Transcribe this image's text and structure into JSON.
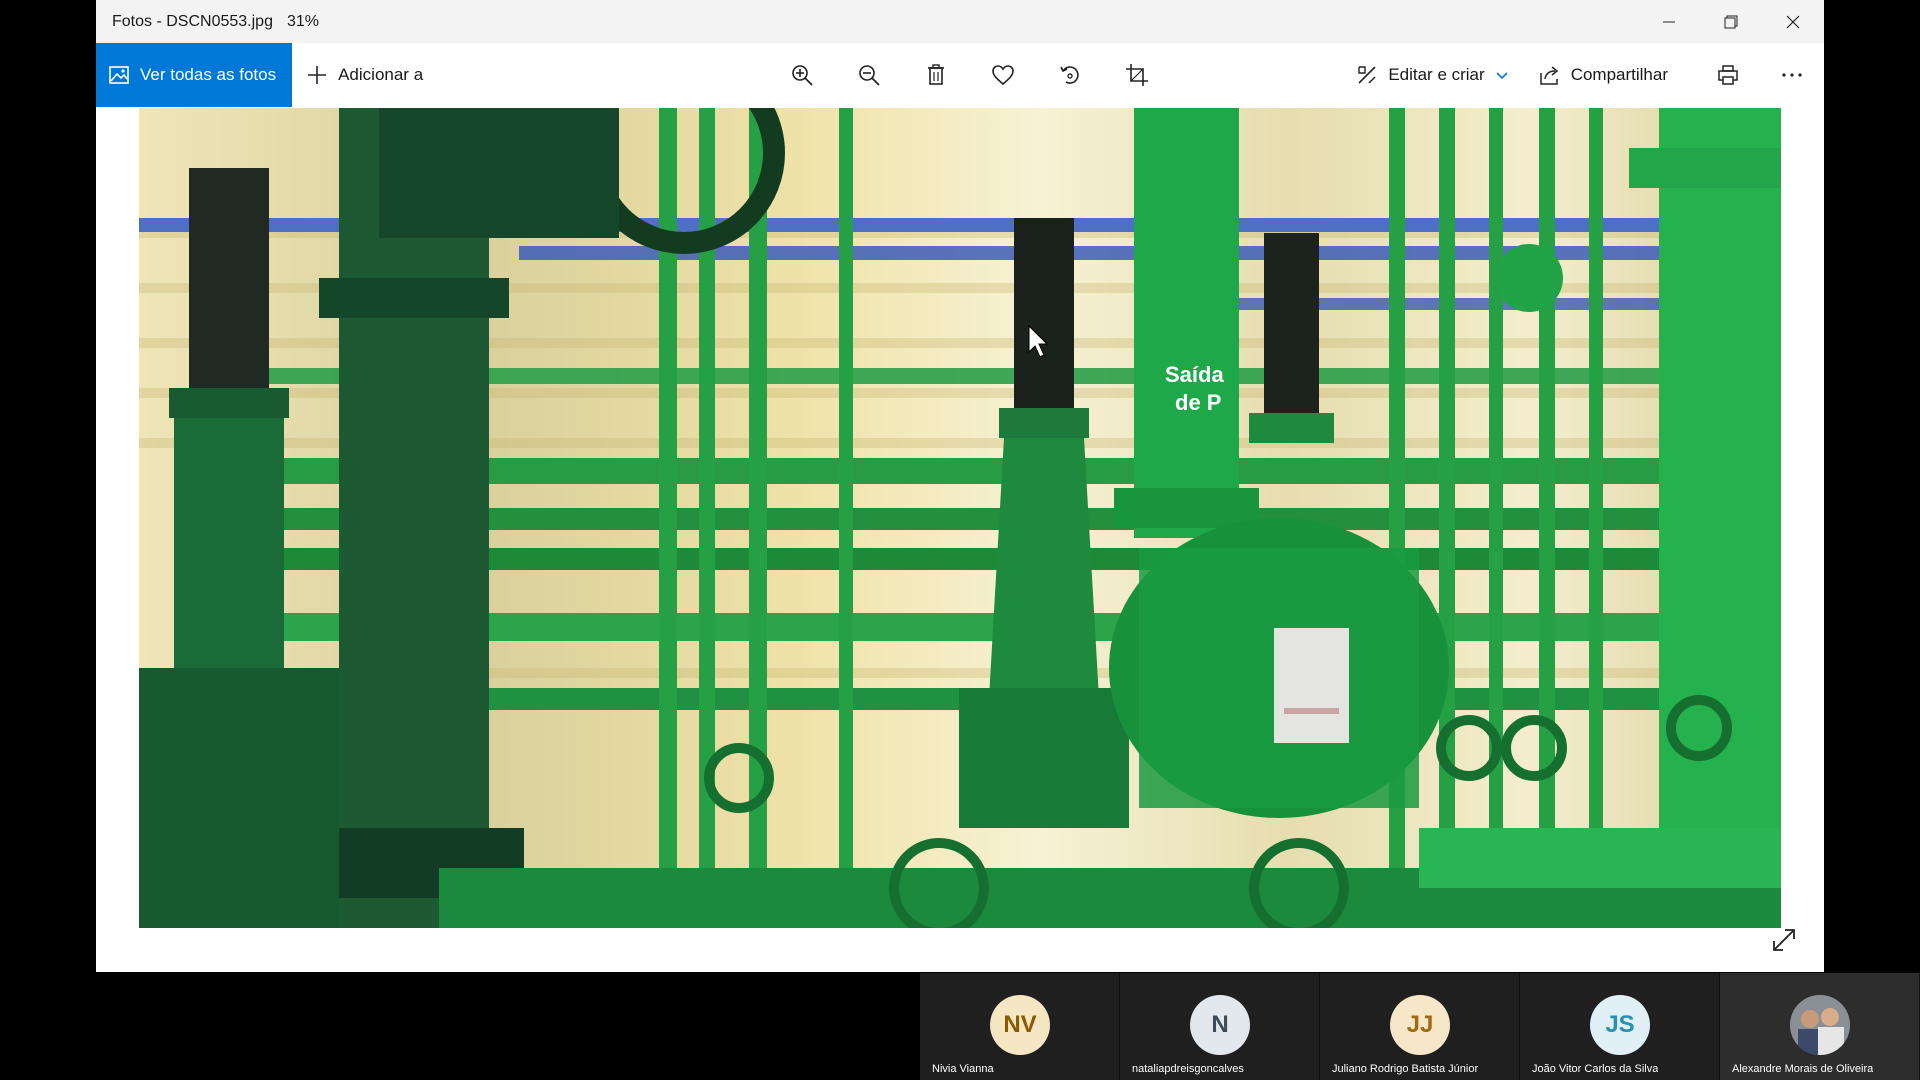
{
  "window": {
    "title": "Fotos - DSCN0553.jpg",
    "zoom": "31%"
  },
  "toolbar": {
    "view_all_label": "Ver todas as fotos",
    "add_to_label": "Adicionar a",
    "edit_create_label": "Editar e criar",
    "share_label": "Compartilhar",
    "icons": [
      "zoom-in-icon",
      "zoom-out-icon",
      "trash-icon",
      "heart-icon",
      "rotate-icon",
      "crop-icon",
      "print-icon",
      "more-icon"
    ]
  },
  "photo": {
    "sign_text_1": "Saída",
    "sign_text_2": "de P"
  },
  "participants": [
    {
      "initials": "NV",
      "name": "Nivia Vianna",
      "avatar_color": "#f5e6c4",
      "text_color": "#8a5a00"
    },
    {
      "initials": "N",
      "name": "nataliapdreisgoncalves",
      "avatar_color": "#e2e8ee",
      "text_color": "#3c4a5a"
    },
    {
      "initials": "JJ",
      "name": "Juliano Rodrigo Batista Júnior",
      "avatar_color": "#f7e7c9",
      "text_color": "#a06a10"
    },
    {
      "initials": "JS",
      "name": "João Vitor Carlos da Silva",
      "avatar_color": "#e0f0f6",
      "text_color": "#2a8fb0"
    },
    {
      "initials": "",
      "name": "Alexandre Morais de Oliveira",
      "avatar_color": "#6b6b6b",
      "text_color": "#ffffff"
    }
  ],
  "colors": {
    "accent": "#0078d7",
    "pipe_green": "#1e9b3c"
  }
}
